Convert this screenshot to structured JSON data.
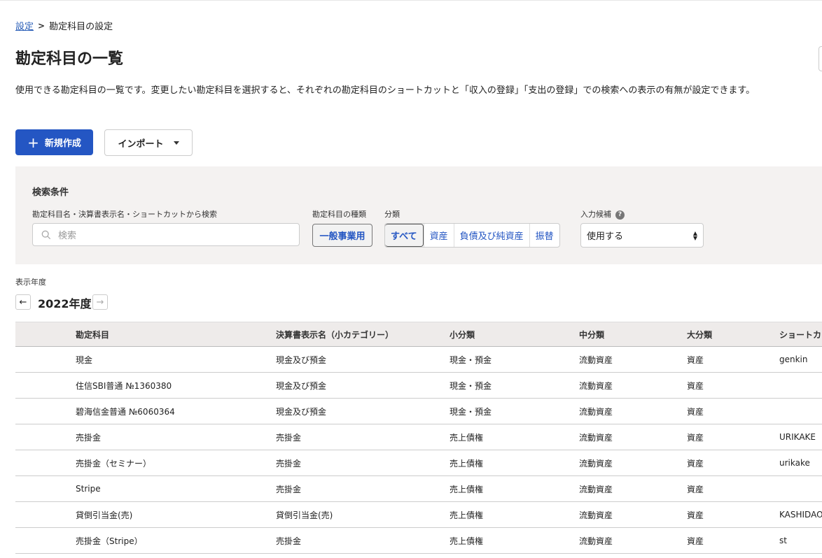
{
  "breadcrumb": {
    "parent": "設定",
    "current": "勘定科目の設定"
  },
  "page": {
    "title": "勘定科目の一覧",
    "description": "使用できる勘定科目の一覧です。変更したい勘定科目を選択すると、それぞれの勘定科目のショートカットと「収入の登録」「支出の登録」での検索への表示の有無が設定できます。"
  },
  "toolbar": {
    "new_label": "新規作成",
    "import_label": "インポート"
  },
  "search_panel": {
    "title": "検索条件",
    "keyword_label": "勘定科目名・決算書表示名・ショートカットから検索",
    "keyword_placeholder": "検索",
    "type_label": "勘定科目の種類",
    "type_value": "一般事業用",
    "category_label": "分類",
    "categories": [
      "すべて",
      "資産",
      "負債及び純資産",
      "振替"
    ],
    "active_category": "すべて",
    "candidate_label": "入力候補",
    "candidate_value": "使用する"
  },
  "year": {
    "label": "表示年度",
    "value": "2022年度"
  },
  "table": {
    "headers": [
      "勘定科目",
      "決算書表示名（小カテゴリー）",
      "小分類",
      "中分類",
      "大分類",
      "ショートカ"
    ],
    "rows": [
      [
        "現金",
        "現金及び預金",
        "現金・預金",
        "流動資産",
        "資産",
        "genkin"
      ],
      [
        "住信SBI普通 №1360380",
        "現金及び預金",
        "現金・預金",
        "流動資産",
        "資産",
        ""
      ],
      [
        "碧海信金普通 №6060364",
        "現金及び預金",
        "現金・預金",
        "流動資産",
        "資産",
        ""
      ],
      [
        "売掛金",
        "売掛金",
        "売上債権",
        "流動資産",
        "資産",
        "URIKAKE"
      ],
      [
        "売掛金（セミナー）",
        "売掛金",
        "売上債権",
        "流動資産",
        "資産",
        "urikake"
      ],
      [
        "Stripe",
        "売掛金",
        "売上債権",
        "流動資産",
        "資産",
        ""
      ],
      [
        "貸倒引当金(売)",
        "貸倒引当金(売)",
        "売上債権",
        "流動資産",
        "資産",
        "KASHIDAO"
      ],
      [
        "売掛金（Stripe）",
        "売掛金",
        "売上債権",
        "流動資産",
        "資産",
        "st"
      ]
    ]
  },
  "colors": {
    "primary": "#2456c3",
    "panel_bg": "#f4f2f1",
    "header_bg": "#eeebea"
  }
}
